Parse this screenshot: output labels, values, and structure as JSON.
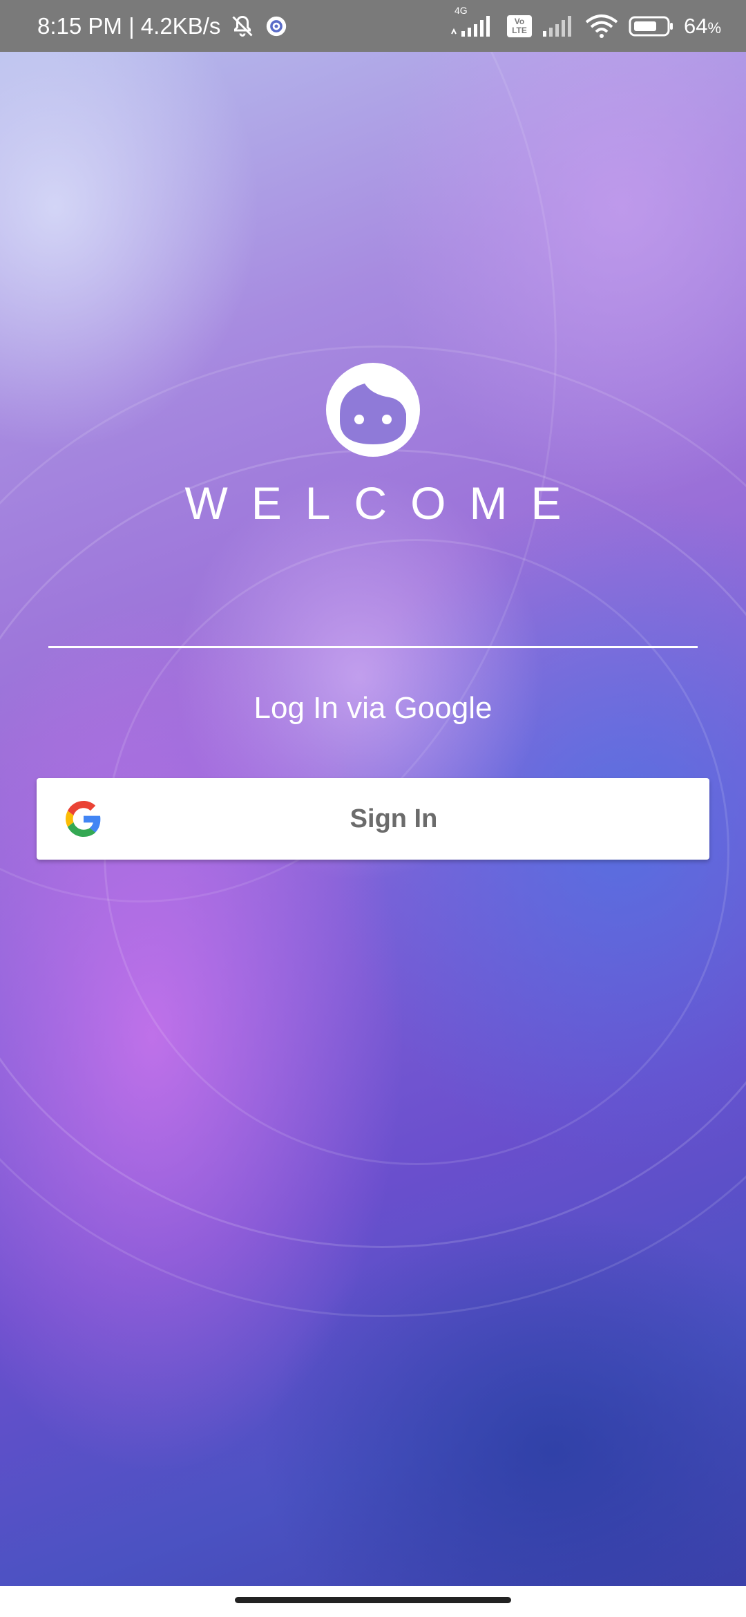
{
  "status_bar": {
    "time_speed": "8:15 PM | 4.2KB/s",
    "network_label": "4G",
    "volte_label": "Vo LTE",
    "battery_percent": "64",
    "battery_unit": "%",
    "icons": [
      "mute-bell-icon",
      "sync-settings-icon",
      "signal-icon",
      "volte-icon",
      "signal-icon-2",
      "wifi-icon",
      "battery-icon"
    ]
  },
  "welcome": {
    "logo_icon": "face-icon",
    "title": "WELCOME"
  },
  "login": {
    "caption": "Log In via Google",
    "signin_label": "Sign In",
    "logo_icon": "google-g-icon"
  },
  "colors": {
    "status_bar_bg": "#7a7a7a",
    "button_bg": "#ffffff",
    "button_text": "#6b6b6b",
    "google_blue": "#4285F4",
    "google_red": "#EA4335",
    "google_yellow": "#FBBC05",
    "google_green": "#34A853"
  }
}
